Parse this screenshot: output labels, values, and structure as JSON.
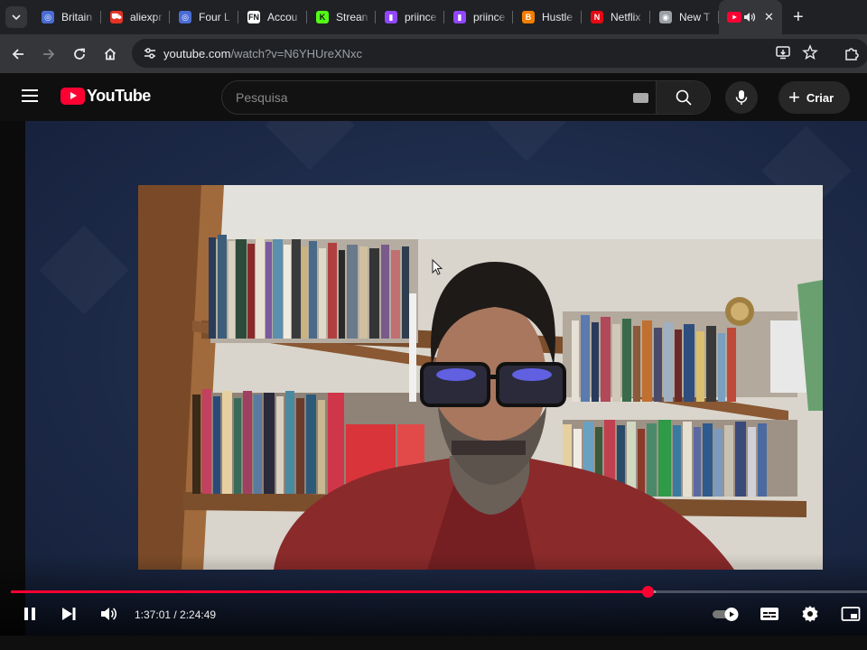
{
  "browser": {
    "tabs": [
      {
        "title": "Britain",
        "color": "#4a6cd4",
        "glyph": "◎"
      },
      {
        "title": "aliexpr",
        "color": "#e43225",
        "glyph": "⛟"
      },
      {
        "title": "Four L",
        "color": "#4a6cd4",
        "glyph": "◎"
      },
      {
        "title": "Accou",
        "color": "#ffffff",
        "glyph": "FN"
      },
      {
        "title": "Strean",
        "color": "#53fc18",
        "glyph": "K"
      },
      {
        "title": "priince",
        "color": "#9146ff",
        "glyph": "▮"
      },
      {
        "title": "priince",
        "color": "#9146ff",
        "glyph": "▮"
      },
      {
        "title": "Hustle",
        "color": "#f57d00",
        "glyph": "B"
      },
      {
        "title": "Netflix",
        "color": "#e50914",
        "glyph": "N"
      },
      {
        "title": "New T",
        "color": "#9aa0a6",
        "glyph": "◉"
      }
    ],
    "active_tab_icon": "youtube-favicon",
    "url_host": "youtube.com",
    "url_path": "/watch?v=N6YHUreXNxc"
  },
  "youtube": {
    "logo_text": "YouTube",
    "search_placeholder": "Pesquisa",
    "create_label": "Criar"
  },
  "player": {
    "current_time": "1:37:01",
    "duration": "2:24:49",
    "time_display": "1:37:01 / 2:24:49",
    "progress_fraction": 0.7435,
    "buffered_fraction": 0.7535,
    "autoplay": true,
    "state": "playing"
  },
  "colors": {
    "accent": "#ff0033",
    "chrome_bg": "#202124",
    "toolbar_bg": "#35363a",
    "yt_bg": "#0f0f0f"
  }
}
